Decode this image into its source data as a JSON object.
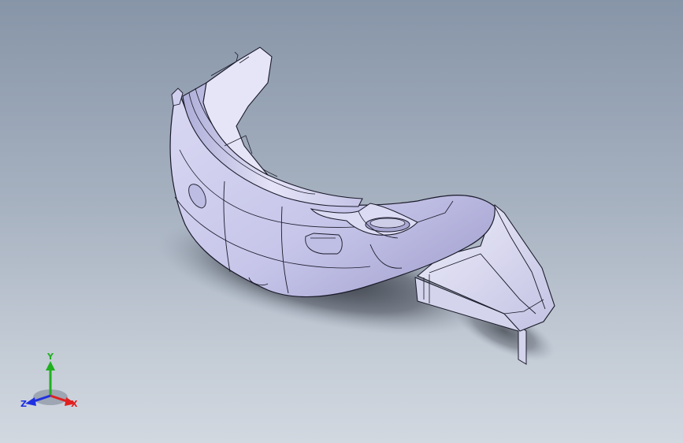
{
  "viewport": {
    "background_top": "#8795a8",
    "background_bottom": "#d2d8e0"
  },
  "model": {
    "face_color": "#c9c8ea",
    "face_shade": "#9c9acb",
    "edge_color": "#1b1b2a"
  },
  "triad": {
    "x_label": "X",
    "y_label": "Y",
    "z_label": "Z",
    "x_color": "#e02020",
    "y_color": "#20b020",
    "z_color": "#2030e0"
  }
}
